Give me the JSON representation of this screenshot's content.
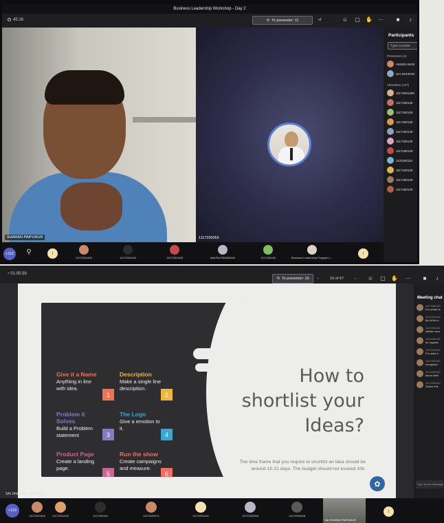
{
  "top": {
    "title": "Business Leadership Workshop - Day 2",
    "timer": "45:16",
    "presenter_btn": "To presenter: 11",
    "page_of": "of",
    "left_video_name": "SHARAN PAIPUNUR",
    "right_video_name": "1117200055",
    "participants": {
      "header": "Participants",
      "search_placeholder": "Type a name",
      "presenters_label": "Presenters (2)",
      "presenters": [
        {
          "name": "AMUDA MAN",
          "role": "Organizer",
          "color": "#c98a6a"
        },
        {
          "name": "SAI SHARAN",
          "role": "",
          "color": "#8fa6c9"
        }
      ],
      "attendees_label": "Attendees (127)",
      "attendees": [
        {
          "name": "11172001400",
          "color": "#d8b48a"
        },
        {
          "name": "1117180140",
          "color": "#c76f6f"
        },
        {
          "name": "1117180140",
          "color": "#9ac27e"
        },
        {
          "name": "1117180130",
          "color": "#d49b55"
        },
        {
          "name": "1117180140",
          "color": "#8aa0c7"
        },
        {
          "name": "1117180140",
          "color": "#d9a6c8"
        },
        {
          "name": "1117180140",
          "color": "#c24b4b"
        },
        {
          "name": "1121180110",
          "color": "#7fb0cf"
        },
        {
          "name": "1117180130",
          "color": "#e0b25a"
        },
        {
          "name": "1117180140",
          "color": "#9c7b60"
        },
        {
          "name": "1117180140",
          "color": "#b35e45"
        }
      ]
    },
    "strip": {
      "more_count": "+112",
      "badge_letter": "I",
      "thumbs": [
        {
          "label": "11172001400",
          "color": "#c98a6a"
        },
        {
          "label": "11172001402",
          "color": "#2d2d2d"
        },
        {
          "label": "11172001408",
          "color": "#c24b4b"
        },
        {
          "label": "AMUDA PAVANSHA",
          "color": "#b7b7c7"
        },
        {
          "label": "1117200140",
          "color": "#7ebf5f"
        },
        {
          "label": "Business Leadership Program L...",
          "color": "#d9d2c6"
        }
      ],
      "end_letter": "I"
    }
  },
  "bottom": {
    "timer": "01:05:59",
    "presenter_btn": "To presenter: 16",
    "pager": {
      "current": "19",
      "total": "47",
      "label": "19 of 47"
    },
    "slide": {
      "items": [
        {
          "title": "Give it a Name",
          "desc": "Anything in line with idea.",
          "num": "1",
          "color": "#ef7350"
        },
        {
          "title": "Description",
          "desc": "Make a single line description.",
          "num": "2",
          "color": "#f0b63c"
        },
        {
          "title": "Problem it Solves",
          "desc": "Build a Problem statement",
          "num": "3",
          "color": "#8877c4"
        },
        {
          "title": "The Logo",
          "desc": "Give a emotion to it.",
          "num": "4",
          "color": "#3aa6d8"
        },
        {
          "title": "Product Page",
          "desc": "Create a landing page.",
          "num": "5",
          "color": "#d06290"
        },
        {
          "title": "Run the show",
          "desc": "Create campaigns and measure.",
          "num": "6",
          "color": "#ef6f63"
        }
      ],
      "heading": "How to shortlist your Ideas?",
      "note": "The time frame that you require to shortlist an idea should be around 15-21 days. The budget should not exceed 10k.",
      "presenter_name": "SAI SHARAN PAIPUNUR"
    },
    "chat": {
      "header": "Meeting chat",
      "messages": [
        {
          "sender": "1117180120",
          "text": "For urban fo"
        },
        {
          "sender": "1117200140",
          "text": "Be fit Be fu"
        },
        {
          "sender": "1117200140",
          "text": "Infinite crea"
        },
        {
          "sender": "1117200140",
          "text": "for organic"
        },
        {
          "sender": "1117200140",
          "text": "For solar e"
        },
        {
          "sender": "1117200140",
          "text": "unorganic"
        },
        {
          "sender": "1117200140",
          "text": "bionic limb"
        },
        {
          "sender": "1117200140",
          "text": "Green ene"
        }
      ],
      "input_placeholder": "Type a new message"
    },
    "strip": {
      "more_count": "+119",
      "thumbs": [
        {
          "label": "11172001400",
          "color": "#c98a6a"
        },
        {
          "label": "11172001402",
          "color": "#e0a06a"
        },
        {
          "label": "1117200140",
          "color": "#2d2d2d"
        },
        {
          "label": "11172003071",
          "color": "#c98a6a"
        },
        {
          "label": "11172001401",
          "color": "#f6e2b0"
        },
        {
          "label": "11172003355",
          "color": "#b7b7c7"
        },
        {
          "label": "11172003408",
          "color": "#5a5a5a"
        }
      ],
      "self_label": "SAI SHARAN PAIPUNUR",
      "end_letter": "I"
    }
  }
}
